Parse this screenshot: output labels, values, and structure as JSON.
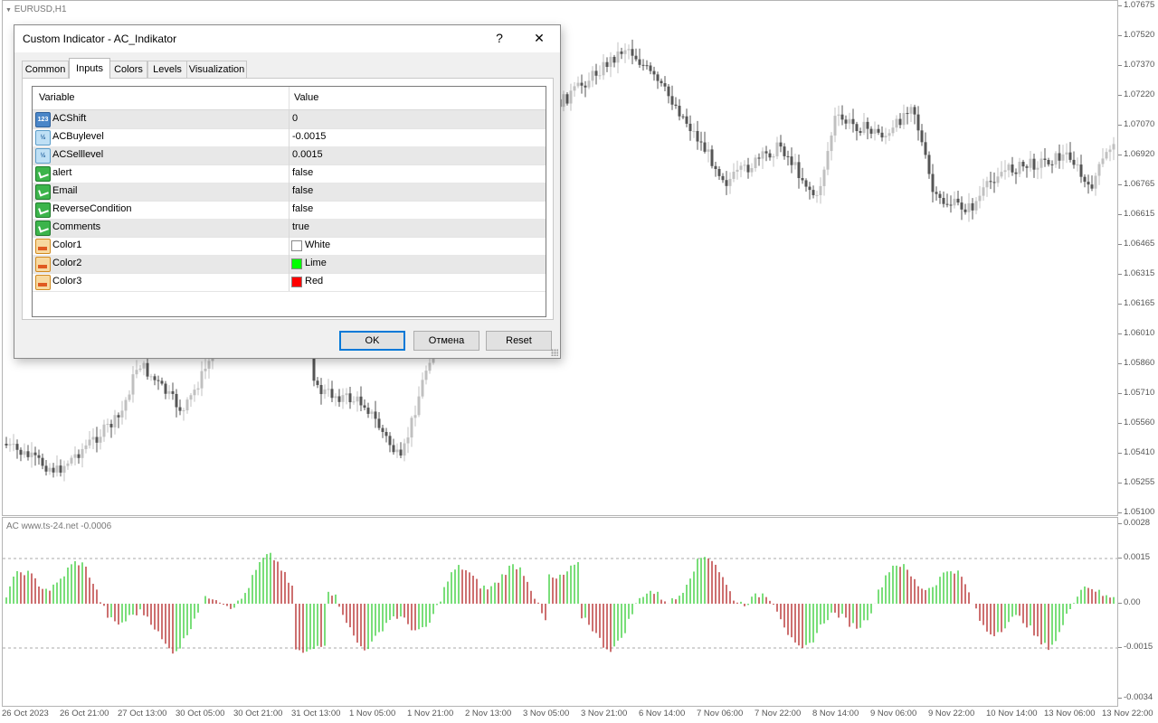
{
  "chart": {
    "symbol_label": "EURUSD,H1",
    "indicator_label": "AC www.ts-24.net -0.0006",
    "price_axis": [
      "1.07675",
      "1.07520",
      "1.07370",
      "1.07220",
      "1.07070",
      "1.06920",
      "1.06765",
      "1.06615",
      "1.06465",
      "1.06315",
      "1.06165",
      "1.06010",
      "1.05860",
      "1.05710",
      "1.05560",
      "1.05410",
      "1.05255",
      "1.05100"
    ],
    "osc_axis": [
      "0.0028",
      "0.0015",
      "0.00",
      "-0.0015",
      "-0.0034"
    ],
    "time_axis": [
      "26 Oct 2023",
      "26 Oct 21:00",
      "27 Oct 13:00",
      "30 Oct 05:00",
      "30 Oct 21:00",
      "31 Oct 13:00",
      "1 Nov 05:00",
      "1 Nov 21:00",
      "2 Nov 13:00",
      "3 Nov 05:00",
      "3 Nov 21:00",
      "6 Nov 14:00",
      "7 Nov 06:00",
      "7 Nov 22:00",
      "8 Nov 14:00",
      "9 Nov 06:00",
      "9 Nov 22:00",
      "10 Nov 14:00",
      "13 Nov 06:00",
      "13 Nov 22:00"
    ],
    "colors": {
      "bullish": "#c0c0c0",
      "bearish": "#555555",
      "ac_up": "#32cd32",
      "ac_down": "#b22222"
    }
  },
  "dialog": {
    "title": "Custom Indicator - AC_Indikator",
    "help_label": "?",
    "close_label": "✕",
    "tabs": [
      "Common",
      "Inputs",
      "Colors",
      "Levels",
      "Visualization"
    ],
    "active_tab": "Inputs",
    "columns": {
      "variable": "Variable",
      "value": "Value"
    },
    "rows": [
      {
        "icon": "int",
        "icon_text": "123",
        "name": "ACShift",
        "value": "0"
      },
      {
        "icon": "double",
        "icon_text": "½",
        "name": "ACBuylevel",
        "value": "-0.0015"
      },
      {
        "icon": "double",
        "icon_text": "½",
        "name": "ACSelllevel",
        "value": "0.0015"
      },
      {
        "icon": "bool",
        "name": "alert",
        "value": "false"
      },
      {
        "icon": "bool",
        "name": "Email",
        "value": "false"
      },
      {
        "icon": "bool",
        "name": "ReverseCondition",
        "value": "false"
      },
      {
        "icon": "bool",
        "name": "Comments",
        "value": "true"
      },
      {
        "icon": "color",
        "name": "Color1",
        "value": "White",
        "swatch": "#ffffff"
      },
      {
        "icon": "color",
        "name": "Color2",
        "value": "Lime",
        "swatch": "#00ff00"
      },
      {
        "icon": "color",
        "name": "Color3",
        "value": "Red",
        "swatch": "#ff0000"
      }
    ],
    "buttons": {
      "ok": "OK",
      "cancel": "Отмена",
      "reset": "Reset"
    }
  }
}
